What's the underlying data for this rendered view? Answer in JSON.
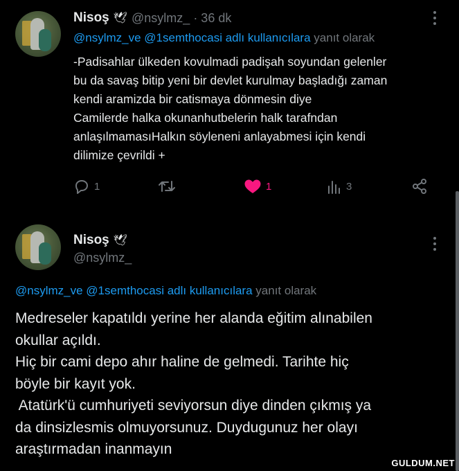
{
  "tweet1": {
    "author_name": "Nisoş",
    "handle": "@nsylmz_",
    "time": "· 36 dk",
    "reply_to_users": "@nsylmz_ve @1semthocasi adlı kullanıcılara",
    "reply_suffix": "yanıt olarak",
    "text_lines": [
      "-Padisahlar ülkeden kovulmadi padişah soyundan gelenler",
      "bu da savaş bitip yeni bir devlet kurulmay başladığı zaman",
      "kendi aramizda bir catismaya dönmesin diye",
      "Camilerde halka okunanhutbelerin halk tarafndan",
      "anlaşılmamasıHalkın söyleneni anlayabmesi için kendi",
      "dilimize çevrildi +"
    ],
    "actions": {
      "reply_count": "1",
      "like_count": "1",
      "views_count": "3"
    },
    "like_color": "#f91880"
  },
  "tweet2": {
    "author_name": "Nisoş",
    "handle": "@nsylmz_",
    "reply_to_users": "@nsylmz_ve @1semthocasi adlı kullanıcılara",
    "reply_suffix": "yanıt olarak",
    "text_lines": [
      "Medreseler kapatıldı yerine her alanda eğitim alınabilen",
      "okullar açıldı.",
      "Hiç bir cami depo ahır haline de gelmedi. Tarihte hiç",
      "böyle bir kayıt yok.",
      " Atatürk'ü cumhuriyeti seviyorsun diye dinden çıkmış ya",
      "da dinsizlesmis olmuyorsunuz. Duydugunuz her olayı",
      "araştırmadan inanmayın"
    ]
  },
  "watermark": "GULDUM.NET",
  "colors": {
    "link": "#1d9bf0",
    "muted": "#71767b",
    "text": "#e7e9ea",
    "background": "#000000"
  },
  "icons": [
    "dove-icon",
    "more-icon",
    "reply-icon",
    "retweet-icon",
    "heart-icon",
    "views-icon",
    "share-icon"
  ]
}
